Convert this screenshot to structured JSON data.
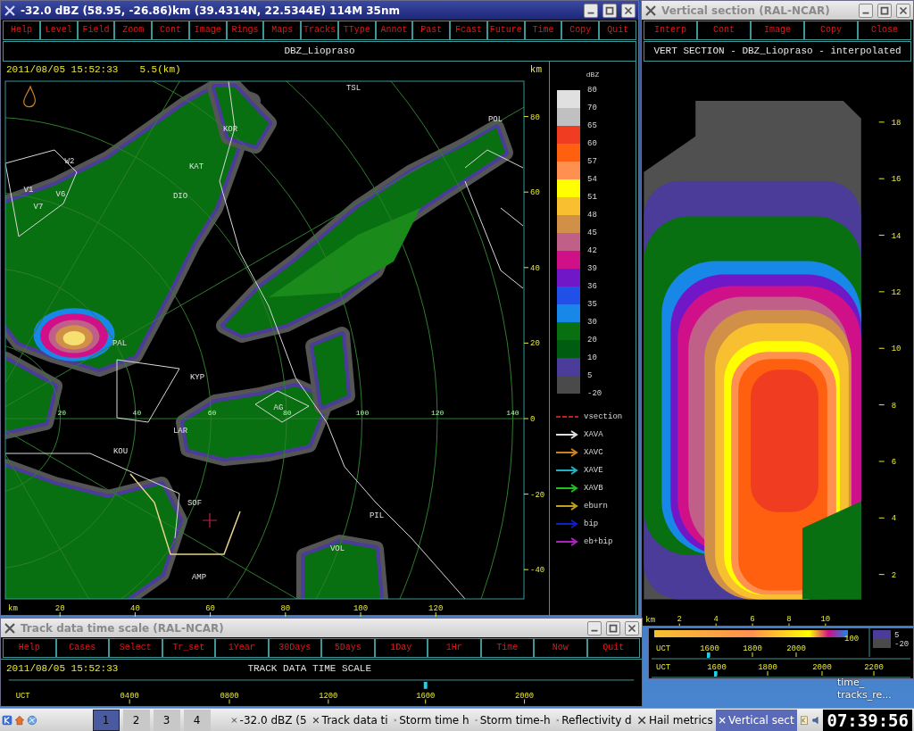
{
  "main_window": {
    "title": "-32.0 dBZ (58.95, -26.86)km (39.4314N, 22.5344E) 114M 35nm",
    "active": true,
    "menu": [
      "Help",
      "Level",
      "Field",
      "Zoom",
      "Cont",
      "Image",
      "Rings",
      "Maps",
      "Tracks",
      "TType",
      "Annot",
      "Past",
      "Fcast",
      "Future",
      "Time",
      "Copy",
      "Quit"
    ],
    "field_title": "DBZ_Liopraso",
    "timestamp": "2011/08/05 15:52:33",
    "height": "5.5(km)",
    "axis_unit": "km",
    "map_labels": [
      "TSL",
      "POL",
      "KOR",
      "W2",
      "KAT",
      "V1",
      "V6",
      "DIO",
      "V7",
      "PAL",
      "KYP",
      "AG",
      "LAR",
      "KOU",
      "SOF",
      "PIL",
      "VOL",
      "AMP"
    ],
    "ring_labels": [
      "20",
      "40",
      "60",
      "80",
      "100",
      "120",
      "140"
    ],
    "x_axis": {
      "label": "km",
      "ticks": [
        "20",
        "40",
        "60",
        "80",
        "100",
        "120"
      ]
    },
    "y_ticks": [
      "80",
      "60",
      "40",
      "20",
      "0",
      "-20",
      "-40"
    ],
    "legend": {
      "title": "dBZ",
      "colors": [
        {
          "color": "#e0e0e0"
        },
        {
          "color": "#c0c0c0"
        },
        {
          "color": "#f03c20"
        },
        {
          "color": "#ff6010"
        },
        {
          "color": "#ff9050"
        },
        {
          "color": "#ffff00"
        },
        {
          "color": "#f8c030"
        },
        {
          "color": "#d09048"
        },
        {
          "color": "#c06088"
        },
        {
          "color": "#d01088"
        },
        {
          "color": "#7018c8"
        },
        {
          "color": "#2050e8"
        },
        {
          "color": "#1888e8"
        },
        {
          "color": "#087010"
        },
        {
          "color": "#005c10"
        },
        {
          "color": "#4a3c98"
        },
        {
          "color": "#4a4a4a"
        }
      ],
      "labels": [
        "80",
        "70",
        "65",
        "60",
        "57",
        "54",
        "51",
        "48",
        "45",
        "42",
        "39",
        "36",
        "35",
        "30",
        "20",
        "10",
        "5",
        "-20"
      ],
      "overlays": [
        {
          "label": "vsection",
          "kind": "dashed",
          "color": "#c02020"
        },
        {
          "label": "XAVA",
          "kind": "arrow",
          "color": "#e0e0e0"
        },
        {
          "label": "XAVC",
          "kind": "arrow",
          "color": "#d08020"
        },
        {
          "label": "XAVE",
          "kind": "arrow",
          "color": "#20b0c0"
        },
        {
          "label": "XAVB",
          "kind": "arrow",
          "color": "#20c020"
        },
        {
          "label": "eburn",
          "kind": "arrow",
          "color": "#c0a020"
        },
        {
          "label": "bip",
          "kind": "arrow",
          "color": "#1020c0"
        },
        {
          "label": "eb+bip",
          "kind": "arrow",
          "color": "#b020c0"
        }
      ]
    }
  },
  "vertical_section_window": {
    "title": "Vertical section (RAL-NCAR)",
    "active": false,
    "menu": [
      "Interp",
      "Cont",
      "Image",
      "Copy",
      "Close"
    ],
    "plot_title": "VERT SECTION - DBZ_Liopraso - interpolated",
    "y_ticks": [
      "18",
      "16",
      "14",
      "12",
      "10",
      "8",
      "6",
      "4",
      "2"
    ],
    "x_axis": {
      "label": "km",
      "ticks": [
        "2",
        "4",
        "6",
        "8",
        "10"
      ]
    }
  },
  "time_height_panels": {
    "band_label": "100",
    "legend": [
      {
        "label": "5",
        "color": "#4a3c98"
      },
      {
        "label": "-20",
        "color": "#4a4a4a"
      }
    ],
    "axes": [
      {
        "label": "UCT",
        "ticks": [
          "1600",
          "1800",
          "2000"
        ]
      },
      {
        "label": "UCT",
        "ticks": [
          "1600",
          "1800",
          "2000",
          "2200"
        ]
      }
    ]
  },
  "track_window": {
    "title": "Track data time scale (RAL-NCAR)",
    "active": false,
    "menu": [
      "Help",
      "Cases",
      "Select",
      "Tr_set",
      "1Year",
      "30Days",
      "5Days",
      "1Day",
      "1Hr",
      "Time",
      "Now",
      "Quit"
    ],
    "timestamp": "2011/08/05 15:52:33",
    "scale_title": "TRACK DATA TIME SCALE",
    "axis": {
      "label": "UCT",
      "ticks": [
        "0400",
        "0800",
        "1200",
        "1600",
        "2000"
      ]
    }
  },
  "desktop_icon": {
    "lines": [
      "time_",
      "tracks_re..."
    ]
  },
  "taskbar": {
    "desktops": [
      {
        "label": "1",
        "selected": true
      },
      {
        "label": "2",
        "selected": false
      },
      {
        "label": "3",
        "selected": false
      },
      {
        "label": "4",
        "selected": false
      }
    ],
    "tasks": [
      {
        "label": "-32.0 dBZ (5",
        "selected": false
      },
      {
        "label": "Track data ti",
        "selected": false
      },
      {
        "label": "Storm time h",
        "selected": false
      },
      {
        "label": "Storm time-h",
        "selected": false
      },
      {
        "label": "Reflectivity d",
        "selected": false
      },
      {
        "label": "Hail metrics",
        "selected": false
      },
      {
        "label": "Vertical sect",
        "selected": true
      }
    ],
    "clock": "07:39:56"
  }
}
